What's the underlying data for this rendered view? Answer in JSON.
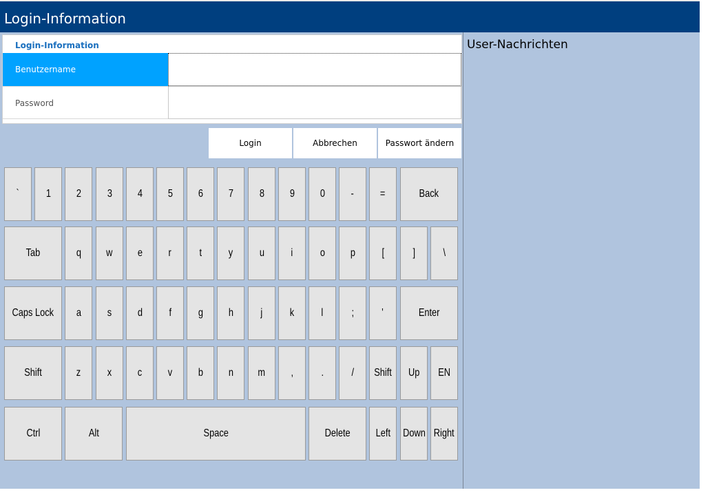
{
  "window": {
    "title": "Login-Information"
  },
  "login": {
    "header": "Login-Information",
    "fields": [
      {
        "label": "Benutzername",
        "value": ""
      },
      {
        "label": "Password",
        "value": ""
      }
    ]
  },
  "actions": {
    "login": "Login",
    "cancel": "Abbrechen",
    "change_password": "Passwort ändern"
  },
  "messages": {
    "title": "User-Nachrichten"
  },
  "keyboard": {
    "rows": [
      [
        "`",
        "1",
        "2",
        "3",
        "4",
        "5",
        "6",
        "7",
        "8",
        "9",
        "0",
        "-",
        "=",
        "Back"
      ],
      [
        "Tab",
        "q",
        "w",
        "e",
        "r",
        "t",
        "y",
        "u",
        "i",
        "o",
        "p",
        "[",
        "]",
        "\\"
      ],
      [
        "Caps Lock",
        "a",
        "s",
        "d",
        "f",
        "g",
        "h",
        "j",
        "k",
        "l",
        ";",
        "'",
        "Enter"
      ],
      [
        "Shift",
        "z",
        "x",
        "c",
        "v",
        "b",
        "n",
        "m",
        ",",
        ".",
        "/",
        "Shift",
        "Up",
        "EN"
      ],
      [
        "Ctrl",
        "Alt",
        "Space",
        "Delete",
        "Left",
        "Down",
        "Right"
      ]
    ]
  },
  "colors": {
    "titlebar": "#003f7f",
    "background": "#b0c4de",
    "active_field": "#00a2ff",
    "header_text": "#1a6fbe",
    "key_face": "#e4e4e4"
  }
}
